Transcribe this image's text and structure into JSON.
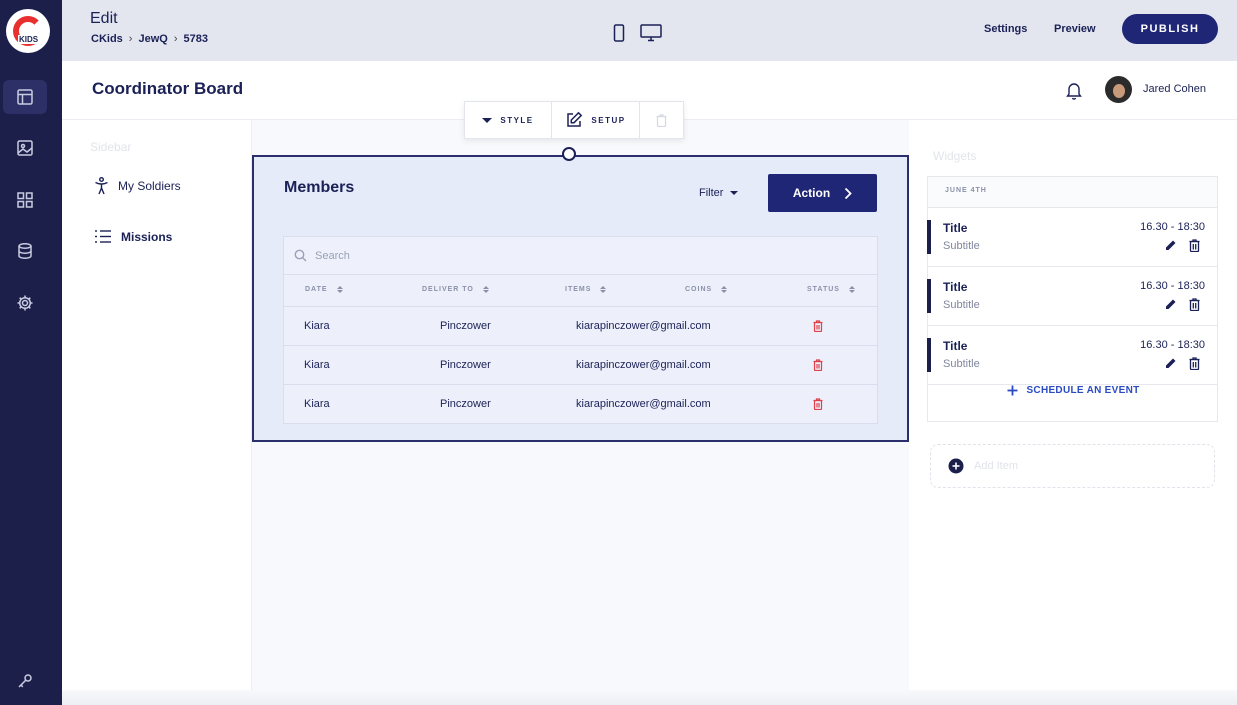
{
  "app": {
    "logo_text": "KIDS"
  },
  "topbar": {
    "mode": "Edit",
    "breadcrumb": [
      "CKids",
      "JewQ",
      "5783"
    ],
    "settings": "Settings",
    "preview": "Preview",
    "publish": "PUBLISH"
  },
  "header": {
    "title": "Coordinator Board",
    "user_name": "Jared Cohen"
  },
  "sidebar": {
    "label": "Sidebar",
    "items": [
      {
        "label": "My Soldiers",
        "icon": "person-icon"
      },
      {
        "label": "Missions",
        "icon": "list-icon"
      }
    ]
  },
  "widget_toolbar": {
    "style": "STYLE",
    "setup": "SETUP"
  },
  "members": {
    "title": "Members",
    "filter": "Filter",
    "action": "Action",
    "search_placeholder": "Search",
    "columns": [
      "DATE",
      "DELIVER TO",
      "ITEMS",
      "COINS",
      "STATUS"
    ],
    "rows": [
      {
        "name": "Kiara",
        "deliver_to": "Pinczower",
        "email": "kiarapinczower@gmail.com"
      },
      {
        "name": "Kiara",
        "deliver_to": "Pinczower",
        "email": "kiarapinczower@gmail.com"
      },
      {
        "name": "Kiara",
        "deliver_to": "Pinczower",
        "email": "kiarapinczower@gmail.com"
      }
    ]
  },
  "widgets": {
    "label": "Widgets",
    "date": "JUNE 4TH",
    "events": [
      {
        "title": "Title",
        "subtitle": "Subtitle",
        "time": "16.30 - 18:30"
      },
      {
        "title": "Title",
        "subtitle": "Subtitle",
        "time": "16.30 - 18:30"
      },
      {
        "title": "Title",
        "subtitle": "Subtitle",
        "time": "16.30 - 18:30"
      }
    ],
    "schedule": "SCHEDULE AN EVENT",
    "add_item": "Add Item"
  },
  "colors": {
    "rail": "#1c1f4a",
    "primary": "#1f2675",
    "selection_bg": "#e6ebfa",
    "delete": "#e0404a",
    "link": "#2a4bc2"
  }
}
